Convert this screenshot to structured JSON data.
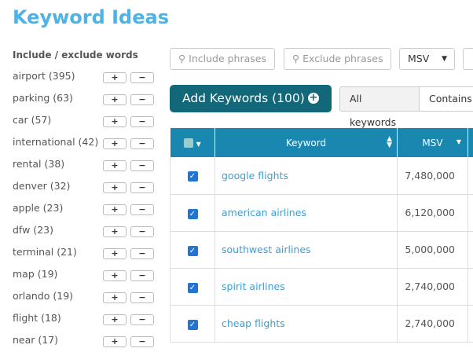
{
  "title": "Keyword Ideas",
  "sidebar": {
    "heading": "Include / exclude words",
    "plus": "+",
    "minus": "−",
    "words": [
      "airport (395)",
      "parking (63)",
      "car (57)",
      "international (42)",
      "rental (38)",
      "denver (32)",
      "apple (23)",
      "dfw (23)",
      "terminal (21)",
      "map (19)",
      "orlando (19)",
      "flight (18)",
      "near (17)"
    ]
  },
  "filters": {
    "include_placeholder": "Include phrases",
    "exclude_placeholder": "Exclude phrases",
    "msv_select": "MSV"
  },
  "add_button": "Add Keywords (100)",
  "segments": [
    "All keywords",
    "Contains"
  ],
  "table": {
    "headers": {
      "keyword": "Keyword",
      "msv": "MSV"
    },
    "rows": [
      {
        "keyword": "google flights",
        "msv": "7,480,000"
      },
      {
        "keyword": "american airlines",
        "msv": "6,120,000"
      },
      {
        "keyword": "southwest airlines",
        "msv": "5,000,000"
      },
      {
        "keyword": "spirit airlines",
        "msv": "2,740,000"
      },
      {
        "keyword": "cheap flights",
        "msv": "2,740,000"
      }
    ]
  }
}
